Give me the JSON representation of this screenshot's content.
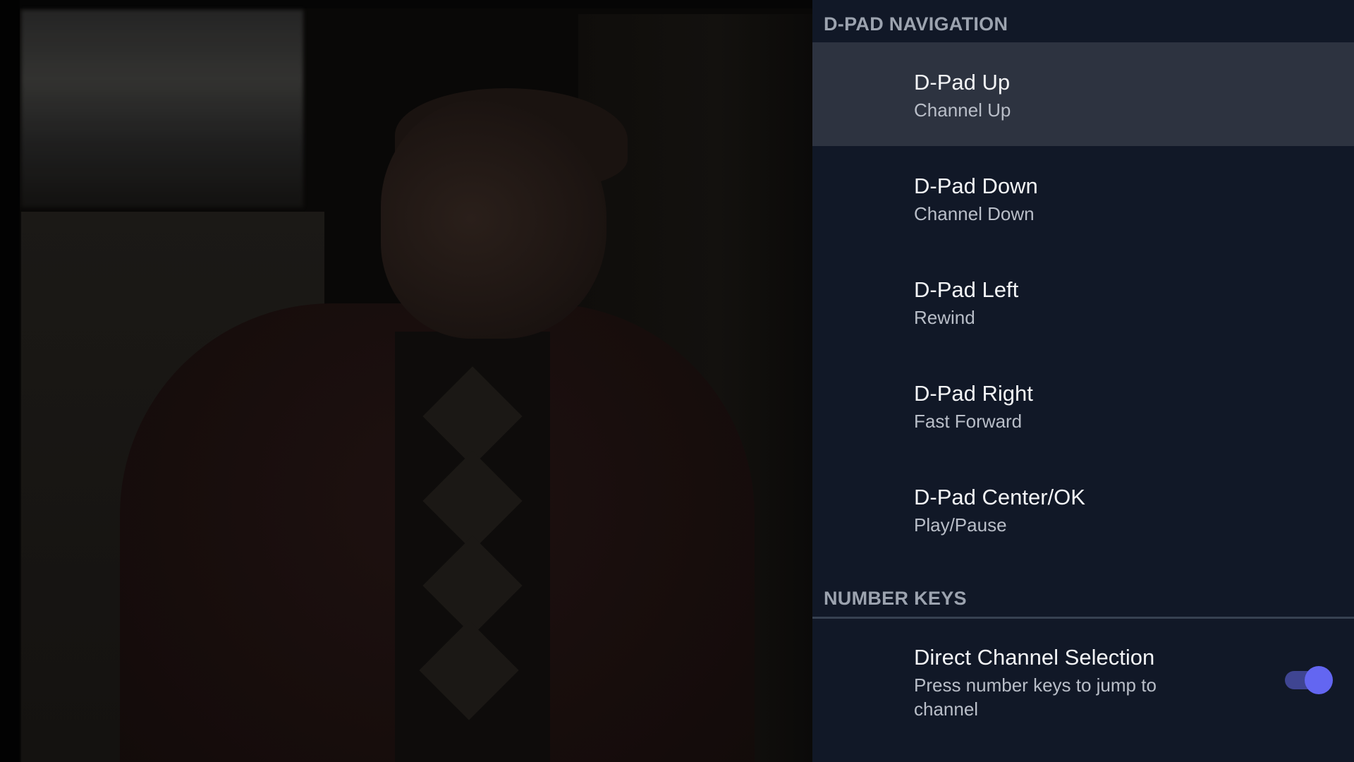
{
  "panel": {
    "sections": [
      {
        "header": "D-PAD NAVIGATION",
        "items": [
          {
            "title": "D-Pad Up",
            "subtitle": "Channel Up",
            "focused": true
          },
          {
            "title": "D-Pad Down",
            "subtitle": "Channel Down"
          },
          {
            "title": "D-Pad Left",
            "subtitle": "Rewind"
          },
          {
            "title": "D-Pad Right",
            "subtitle": "Fast Forward"
          },
          {
            "title": "D-Pad Center/OK",
            "subtitle": "Play/Pause"
          }
        ]
      },
      {
        "header": "NUMBER KEYS",
        "items": [
          {
            "title": "Direct Channel Selection",
            "subtitle": "Press number keys to jump to channel",
            "toggle": true,
            "toggle_on": true
          }
        ]
      }
    ]
  },
  "colors": {
    "panel_bg": "#111827",
    "focused_row": "#2d3340",
    "toggle_accent": "#6366f1"
  }
}
